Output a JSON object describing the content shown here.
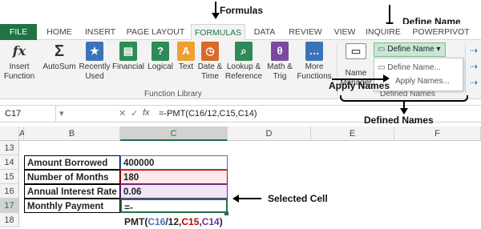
{
  "annotations": {
    "formulas": "Formulas",
    "define_name": "Define Name",
    "apply_names": "Apply Names",
    "defined_names": "Defined Names",
    "selected_cell": "Selected Cell"
  },
  "tabs": [
    "FILE",
    "HOME",
    "INSERT",
    "PAGE LAYOUT",
    "FORMULAS",
    "DATA",
    "REVIEW",
    "VIEW",
    "INQUIRE",
    "POWERPIVOT"
  ],
  "ribbon": {
    "insert_function": [
      "Insert",
      "Function"
    ],
    "autosum": "AutoSum",
    "recently_used": [
      "Recently",
      "Used"
    ],
    "financial": "Financial",
    "logical": "Logical",
    "text": "Text",
    "date_time": [
      "Date &",
      "Time"
    ],
    "lookup_reference": [
      "Lookup &",
      "Reference"
    ],
    "math_trig": [
      "Math &",
      "Trig"
    ],
    "more_functions": [
      "More",
      "Functions"
    ],
    "function_library": "Function Library",
    "name_manager": [
      "Name",
      "Manager"
    ],
    "defined_names_group": "Defined Names",
    "define_name_button": "Define Name",
    "dropdown": [
      "Define Name...",
      "Apply Names..."
    ]
  },
  "formula_bar": {
    "name_box": "C17",
    "fx": "fx",
    "formula": "=-PMT(C16/12,C15,C14)"
  },
  "grid": {
    "columns": [
      "A",
      "B",
      "C",
      "D",
      "E",
      "F"
    ],
    "rows": [
      {
        "num": "13",
        "label": "",
        "value": ""
      },
      {
        "num": "14",
        "label": "Amount Borrowed",
        "value": "400000"
      },
      {
        "num": "15",
        "label": "Number of Months",
        "value": "180"
      },
      {
        "num": "16",
        "label": "Annual Interest Rate",
        "value": "0.06"
      },
      {
        "num": "17",
        "label": "Monthly Payment",
        "value": "=-PMT(C16/12,C15,C14)"
      },
      {
        "num": "18",
        "label": "",
        "value": ""
      }
    ]
  },
  "colors": {
    "excel_green": "#217346",
    "ref_blue": "#4472c4",
    "ref_red": "#c00000",
    "ref_purple": "#7030a0"
  }
}
